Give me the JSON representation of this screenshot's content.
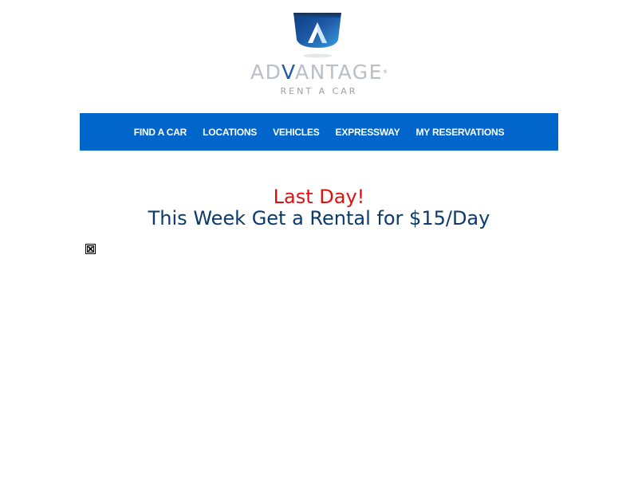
{
  "logo": {
    "wordmark_prefix": "AD",
    "wordmark_accent": "V",
    "wordmark_suffix": "ANTAGE",
    "trademark": "®",
    "tagline": "RENT A CAR",
    "icon": "advantage-emblem-icon",
    "colors": {
      "emblem_dark": "#1e4f9c",
      "emblem_light": "#3aa0e0",
      "wordmark_gray": "#b9bfc6",
      "wordmark_blue": "#1e5aa8"
    }
  },
  "nav": {
    "background": "#0066cc",
    "items": [
      {
        "label": "FIND A CAR"
      },
      {
        "label": "LOCATIONS"
      },
      {
        "label": "VEHICLES"
      },
      {
        "label": "EXPRESSWAY"
      },
      {
        "label": "MY RESERVATIONS"
      }
    ]
  },
  "promo": {
    "line1": "Last Day!",
    "line2": "This Week Get a Rental for $15/Day",
    "line1_color": "#e01010",
    "line2_color": "#0c3a6b"
  },
  "broken_image": {
    "icon": "broken-image-icon"
  }
}
